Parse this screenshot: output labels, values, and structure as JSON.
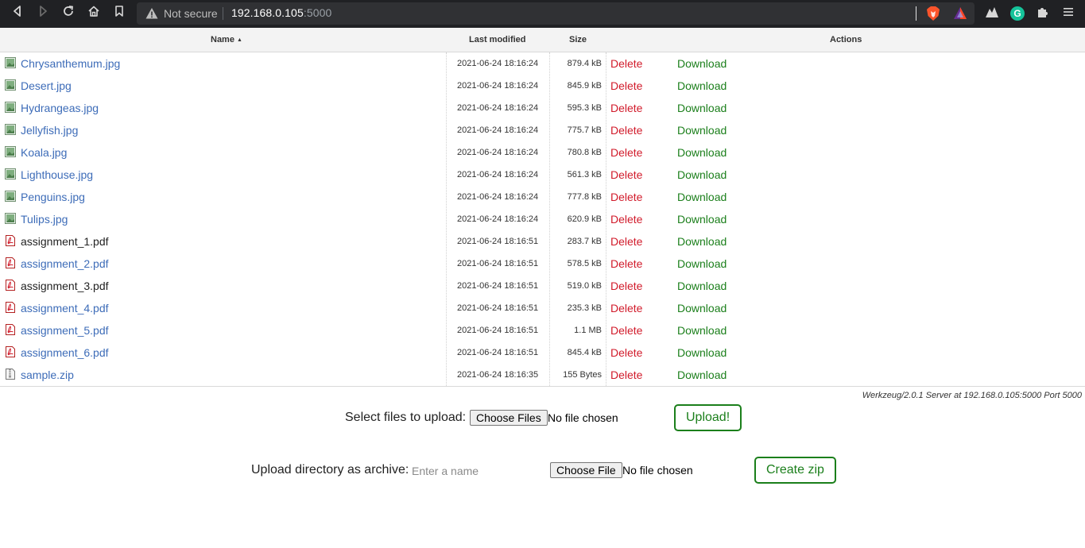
{
  "browser": {
    "security_label": "Not secure",
    "url_host": "192.168.0.105",
    "url_port": ":5000",
    "icons": [
      "back-icon",
      "forward-icon",
      "reload-icon",
      "home-icon",
      "bookmark-icon",
      "warning-icon",
      "brave-shield-icon",
      "brave-rewards-icon",
      "extension-icon",
      "grammarly-icon",
      "puzzle-icon",
      "menu-icon"
    ],
    "grammarly_letter": "G"
  },
  "table": {
    "headers": {
      "name": "Name",
      "sort_arrow": "▲",
      "last_modified": "Last modified",
      "size": "Size",
      "actions": "Actions"
    },
    "delete_label": "Delete",
    "download_label": "Download",
    "rows": [
      {
        "name": "Chrysanthemum.jpg",
        "modified": "2021-06-24 18:16:24",
        "size": "879.4 kB",
        "icon": "image-icon",
        "link": true
      },
      {
        "name": "Desert.jpg",
        "modified": "2021-06-24 18:16:24",
        "size": "845.9 kB",
        "icon": "image-icon",
        "link": true
      },
      {
        "name": "Hydrangeas.jpg",
        "modified": "2021-06-24 18:16:24",
        "size": "595.3 kB",
        "icon": "image-icon",
        "link": true
      },
      {
        "name": "Jellyfish.jpg",
        "modified": "2021-06-24 18:16:24",
        "size": "775.7 kB",
        "icon": "image-icon",
        "link": true
      },
      {
        "name": "Koala.jpg",
        "modified": "2021-06-24 18:16:24",
        "size": "780.8 kB",
        "icon": "image-icon",
        "link": true
      },
      {
        "name": "Lighthouse.jpg",
        "modified": "2021-06-24 18:16:24",
        "size": "561.3 kB",
        "icon": "image-icon",
        "link": true
      },
      {
        "name": "Penguins.jpg",
        "modified": "2021-06-24 18:16:24",
        "size": "777.8 kB",
        "icon": "image-icon",
        "link": true
      },
      {
        "name": "Tulips.jpg",
        "modified": "2021-06-24 18:16:24",
        "size": "620.9 kB",
        "icon": "image-icon",
        "link": true
      },
      {
        "name": "assignment_1.pdf",
        "modified": "2021-06-24 18:16:51",
        "size": "283.7 kB",
        "icon": "pdf-icon",
        "link": false
      },
      {
        "name": "assignment_2.pdf",
        "modified": "2021-06-24 18:16:51",
        "size": "578.5 kB",
        "icon": "pdf-icon",
        "link": true
      },
      {
        "name": "assignment_3.pdf",
        "modified": "2021-06-24 18:16:51",
        "size": "519.0 kB",
        "icon": "pdf-icon",
        "link": false
      },
      {
        "name": "assignment_4.pdf",
        "modified": "2021-06-24 18:16:51",
        "size": "235.3 kB",
        "icon": "pdf-icon",
        "link": true
      },
      {
        "name": "assignment_5.pdf",
        "modified": "2021-06-24 18:16:51",
        "size": "1.1 MB",
        "icon": "pdf-icon",
        "link": true
      },
      {
        "name": "assignment_6.pdf",
        "modified": "2021-06-24 18:16:51",
        "size": "845.4 kB",
        "icon": "pdf-icon",
        "link": true
      },
      {
        "name": "sample.zip",
        "modified": "2021-06-24 18:16:35",
        "size": "155 Bytes",
        "icon": "zip-icon",
        "link": true
      }
    ]
  },
  "footer": {
    "server_signature": "Werkzeug/2.0.1 Server at 192.168.0.105:5000 Port 5000"
  },
  "upload_files": {
    "label": "Select files to upload:",
    "choose_label": "Choose Files",
    "status": "No file chosen",
    "submit_label": "Upload!"
  },
  "upload_dir": {
    "label": "Upload directory as archive:",
    "name_placeholder": "Enter a name",
    "choose_label": "Choose File",
    "status": "No file chosen",
    "submit_label": "Create zip"
  },
  "colors": {
    "link": "#3d6cb8",
    "delete": "#d11a2a",
    "download": "#1b7f1b",
    "chrome_bg": "#202124"
  }
}
